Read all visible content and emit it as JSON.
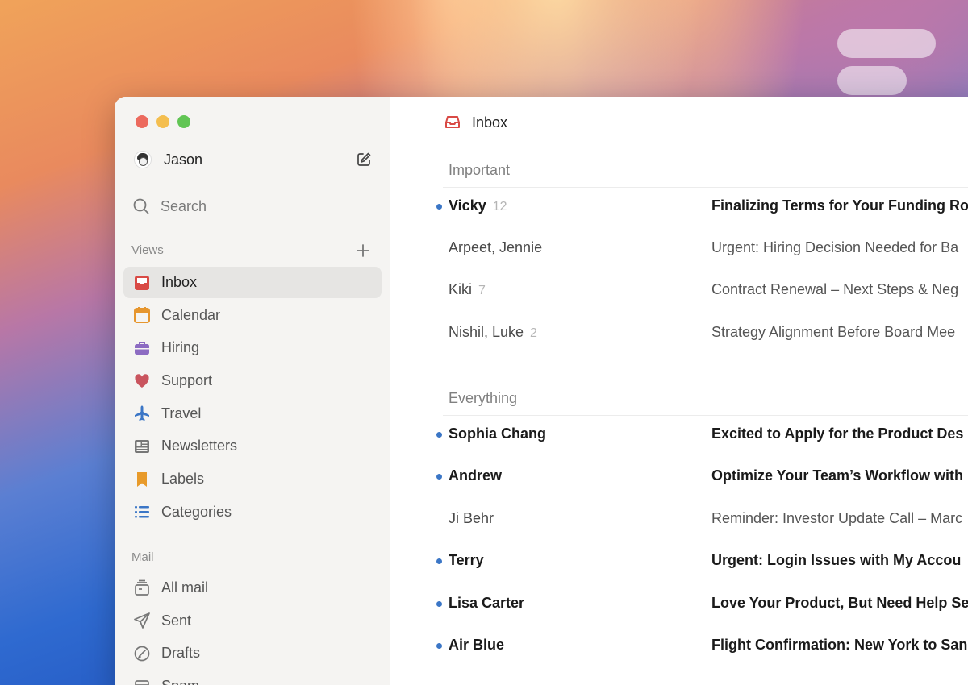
{
  "colors": {
    "accent_blue": "#3b76c6",
    "inbox_red": "#d94a45",
    "calendar_orange": "#e6962e",
    "hiring_purple": "#8c6bc2",
    "support_red": "#c9545e",
    "labels_orange": "#e89a2a"
  },
  "account": {
    "name": "Jason"
  },
  "search": {
    "label": "Search"
  },
  "sidebar": {
    "views_label": "Views",
    "views": [
      {
        "label": "Inbox",
        "icon": "inbox-tray-icon",
        "active": true
      },
      {
        "label": "Calendar",
        "icon": "calendar-icon"
      },
      {
        "label": "Hiring",
        "icon": "briefcase-icon"
      },
      {
        "label": "Support",
        "icon": "heart-icon"
      },
      {
        "label": "Travel",
        "icon": "airplane-icon"
      },
      {
        "label": "Newsletters",
        "icon": "newspaper-icon"
      },
      {
        "label": "Labels",
        "icon": "bookmark-icon"
      },
      {
        "label": "Categories",
        "icon": "list-icon"
      }
    ],
    "mail_label": "Mail",
    "mail": [
      {
        "label": "All mail",
        "icon": "archive-icon"
      },
      {
        "label": "Sent",
        "icon": "paper-plane-icon"
      },
      {
        "label": "Drafts",
        "icon": "draft-icon"
      },
      {
        "label": "Spam",
        "icon": "spam-icon"
      }
    ]
  },
  "main": {
    "title": "Inbox",
    "important": {
      "title": "Important",
      "rows": [
        {
          "sender": "Vicky",
          "count": "12",
          "subject": "Finalizing Terms for Your Funding Ro",
          "unread": true
        },
        {
          "sender": "Arpeet, Jennie",
          "count": "",
          "subject": "Urgent: Hiring Decision Needed for Ba",
          "unread": false
        },
        {
          "sender": "Kiki",
          "count": "7",
          "subject": "Contract Renewal – Next Steps & Neg",
          "unread": false
        },
        {
          "sender": "Nishil, Luke",
          "count": "2",
          "subject": "Strategy Alignment Before Board Mee",
          "unread": false
        }
      ]
    },
    "everything": {
      "title": "Everything",
      "rows": [
        {
          "sender": "Sophia Chang",
          "count": "",
          "subject": "Excited to Apply for the Product Des",
          "unread": true
        },
        {
          "sender": "Andrew",
          "count": "",
          "subject": "Optimize Your Team’s Workflow with",
          "unread": true
        },
        {
          "sender": "Ji Behr",
          "count": "",
          "subject": "Reminder: Investor Update Call – Marc",
          "unread": false
        },
        {
          "sender": "Terry",
          "count": "",
          "subject": "Urgent: Login Issues with My Accou",
          "unread": true
        },
        {
          "sender": "Lisa Carter",
          "count": "",
          "subject": "Love Your Product, But Need Help Se",
          "unread": true
        },
        {
          "sender": "Air Blue",
          "count": "",
          "subject": "Flight Confirmation: New York to San",
          "unread": true
        }
      ]
    }
  }
}
